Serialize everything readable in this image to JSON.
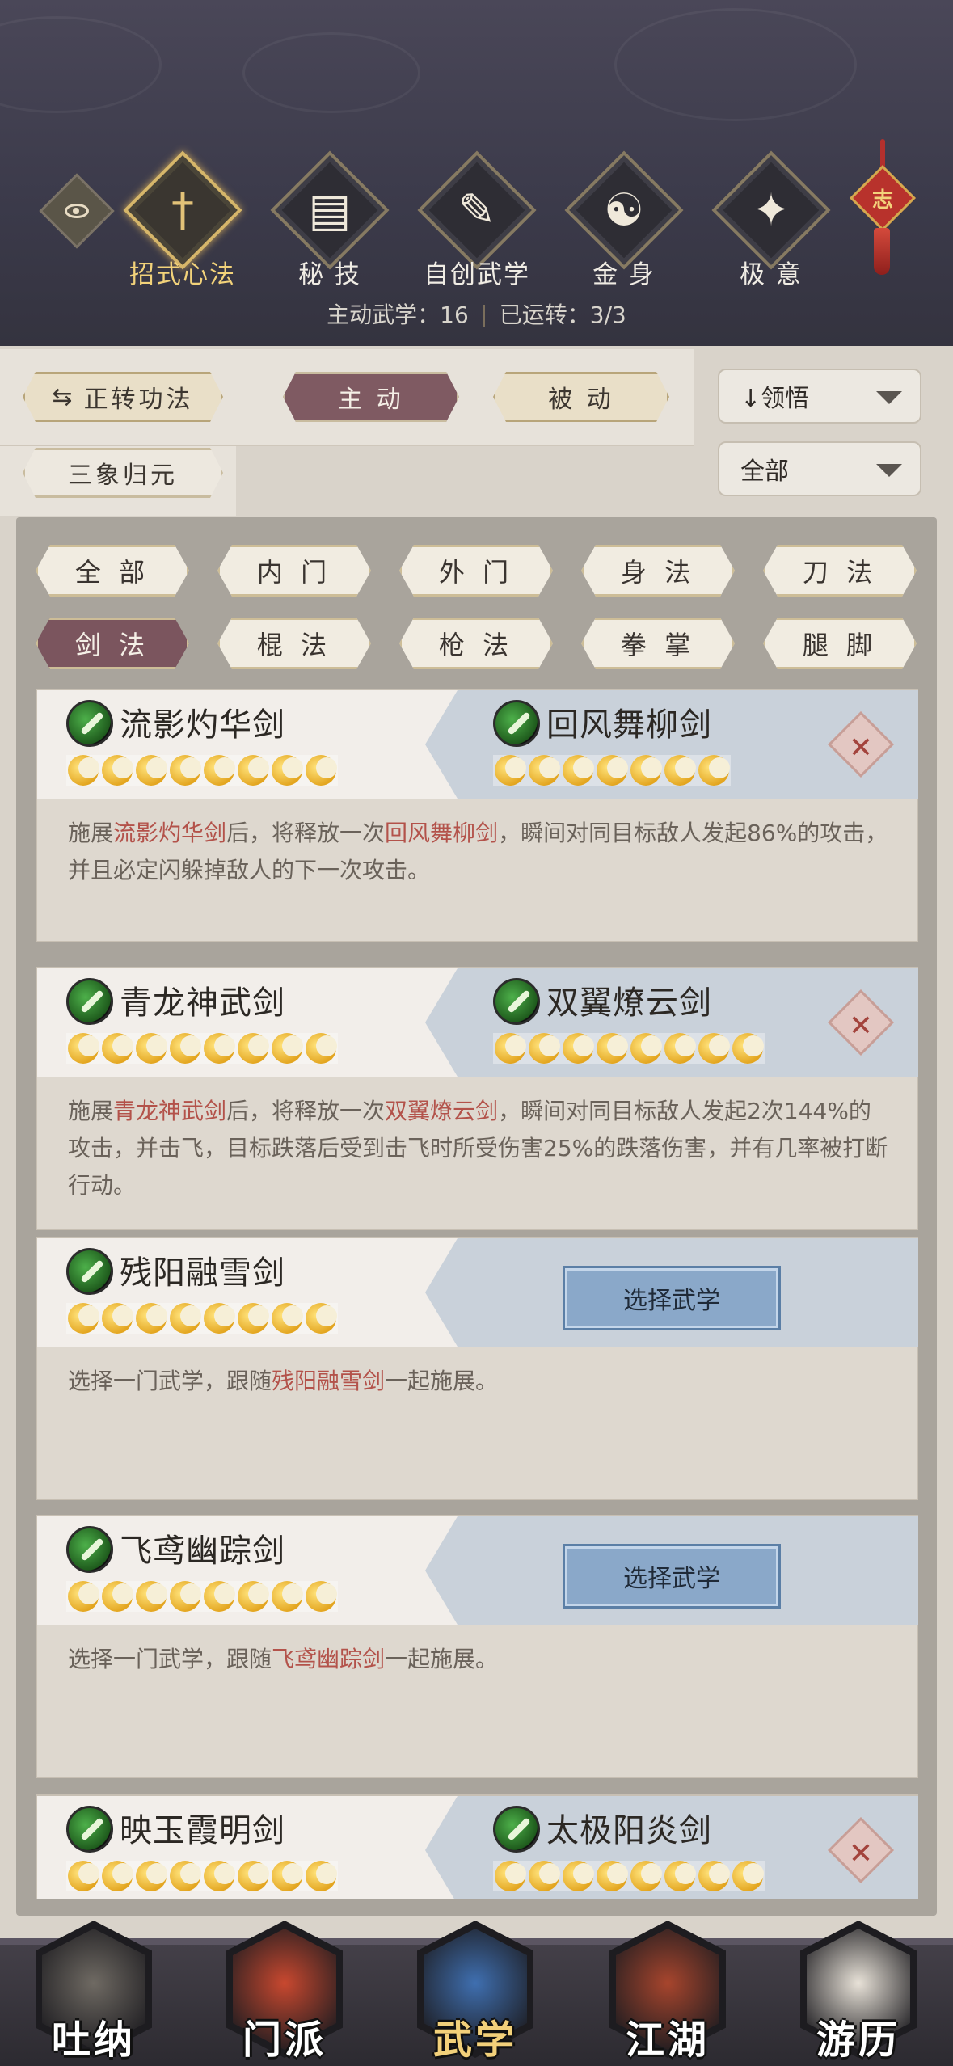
{
  "header": {
    "categories": [
      {
        "label": "招式心法",
        "icon": "sword-icon",
        "glyph": "†"
      },
      {
        "label": "秘 技",
        "icon": "book-icon",
        "glyph": "▤"
      },
      {
        "label": "自创武学",
        "icon": "scroll-icon",
        "glyph": "✎"
      },
      {
        "label": "金 身",
        "icon": "meditation-icon",
        "glyph": "☯"
      },
      {
        "label": "极 意",
        "icon": "martial-pose-icon",
        "glyph": "✦"
      }
    ],
    "knot_char": "志",
    "stats": {
      "active_label": "主动武学：16",
      "used_label": "已运转：3/3"
    }
  },
  "filters": {
    "rotate_button": "正转功法",
    "mode_tabs": [
      "主 动",
      "被 动"
    ],
    "sanxiang_button": "三象归元",
    "sort_dropdown": "↓领悟",
    "range_dropdown": "全部"
  },
  "type_tabs": [
    "全 部",
    "内 门",
    "外 门",
    "身 法",
    "刀 法",
    "剑 法",
    "棍 法",
    "枪 法",
    "拳 掌",
    "腿 脚"
  ],
  "cards": [
    {
      "left": {
        "name": "流影灼华剑",
        "stars": 8
      },
      "right": {
        "name": "回风舞柳剑",
        "stars": 7
      },
      "desc_parts": [
        "施展",
        "流影灼华剑",
        "后，将释放一次",
        "回风舞柳剑",
        "，瞬间对同目标敌人发起86%的攻击，并且必定闪躲掉敌人的下一次攻击。"
      ]
    },
    {
      "left": {
        "name": "青龙神武剑",
        "stars": 8
      },
      "right": {
        "name": "双翼燎云剑",
        "stars": 8
      },
      "desc_parts": [
        "施展",
        "青龙神武剑",
        "后，将释放一次",
        "双翼燎云剑",
        "，瞬间对同目标敌人发起2次144%的攻击，并击飞，目标跌落后受到击飞时所受伤害25%的跌落伤害，并有几率被打断行动。"
      ]
    },
    {
      "left": {
        "name": "残阳融雪剑",
        "stars": 8
      },
      "choose_label": "选择武学",
      "desc_parts": [
        "选择一门武学，跟随",
        "残阳融雪剑",
        "一起施展。"
      ]
    },
    {
      "left": {
        "name": "飞鸢幽踪剑",
        "stars": 8
      },
      "choose_label": "选择武学",
      "desc_parts": [
        "选择一门武学，跟随",
        "飞鸢幽踪剑",
        "一起施展。"
      ]
    },
    {
      "left": {
        "name": "映玉霞明剑",
        "stars": 8
      },
      "right": {
        "name": "太极阳炎剑",
        "stars": 8
      }
    }
  ],
  "close_symbol": "✕",
  "bottom_nav": [
    {
      "label": "吐纳",
      "icon": "meditating-figure-icon",
      "color": "#6f6a63"
    },
    {
      "label": "门派",
      "icon": "sect-banner-icon",
      "color": "#c8482f"
    },
    {
      "label": "武学",
      "icon": "martial-book-icon",
      "color": "#3f6fb0"
    },
    {
      "label": "江湖",
      "icon": "straw-hat-icon",
      "color": "#a7452d"
    },
    {
      "label": "游历",
      "icon": "white-horse-icon",
      "color": "#e8e2d8"
    }
  ]
}
